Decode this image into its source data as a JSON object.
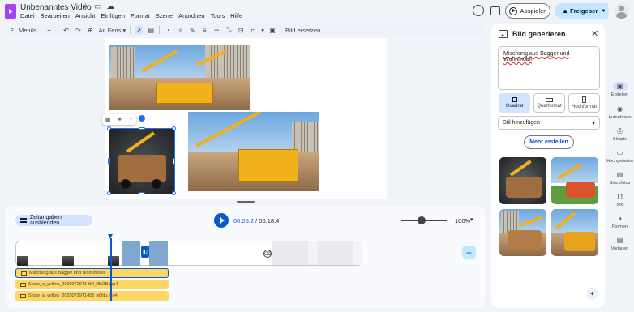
{
  "app": {
    "title": "Unbenanntes Video",
    "menu": [
      "Datei",
      "Bearbeiten",
      "Ansicht",
      "Einfügen",
      "Format",
      "Szene",
      "Anordnen",
      "Tools",
      "Hilfe"
    ],
    "play_label": "Abspielen",
    "share_label": "Freigeben"
  },
  "toolbar": {
    "menus_label": "Menüs",
    "zoom_label": "An Fens",
    "replace_image_label": "Bild ersetzen"
  },
  "timeline": {
    "toggle_timing_label": "Zeitangaben ausblenden",
    "time_current": "00:05.2",
    "time_sep": " / ",
    "time_total": "00:18.4",
    "zoom_level": "100%",
    "zoom_slider_fraction": 0.4,
    "audio_tracks": [
      "Mischung aus Bagger und Wohnmobil",
      "Show_a_yellow_20250729T1454_lfbOB.mp4",
      "Show_a_yellow_20250729T1455_sQjtu.mp4"
    ]
  },
  "panel": {
    "title": "Bild generieren",
    "prompt": "Mischung aus Bagger und Wohnmobil",
    "formats": [
      "Quadrat",
      "Querformat",
      "Hochformat"
    ],
    "selected_format": "Quadrat",
    "style_label": "Stil hinzufügen",
    "more_label": "Mehr erstellen"
  },
  "rail": [
    "Erstellen",
    "Aufnehmen",
    "Skripte",
    "Hochgeladen",
    "Stockfotos",
    "Text",
    "Formen",
    "Vorlagen"
  ],
  "colors": {
    "accent": "#0b57d0",
    "share_bg": "#c2e7ff",
    "audio_track": "#fdd663",
    "selection": "#1a73e8"
  }
}
